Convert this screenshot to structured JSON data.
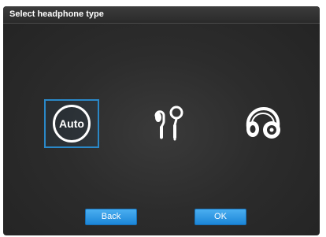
{
  "dialog": {
    "title": "Select headphone type"
  },
  "options": {
    "auto_label": "Auto",
    "selected": "Auto",
    "icons": [
      "auto-icon",
      "earbuds-icon",
      "headphones-icon"
    ]
  },
  "buttons": {
    "back_label": "Back",
    "ok_label": "OK"
  },
  "colors": {
    "background": "#2c2c2c",
    "selection_border": "#2a88c8",
    "button": "#2a96e0",
    "text": "#ffffff"
  }
}
